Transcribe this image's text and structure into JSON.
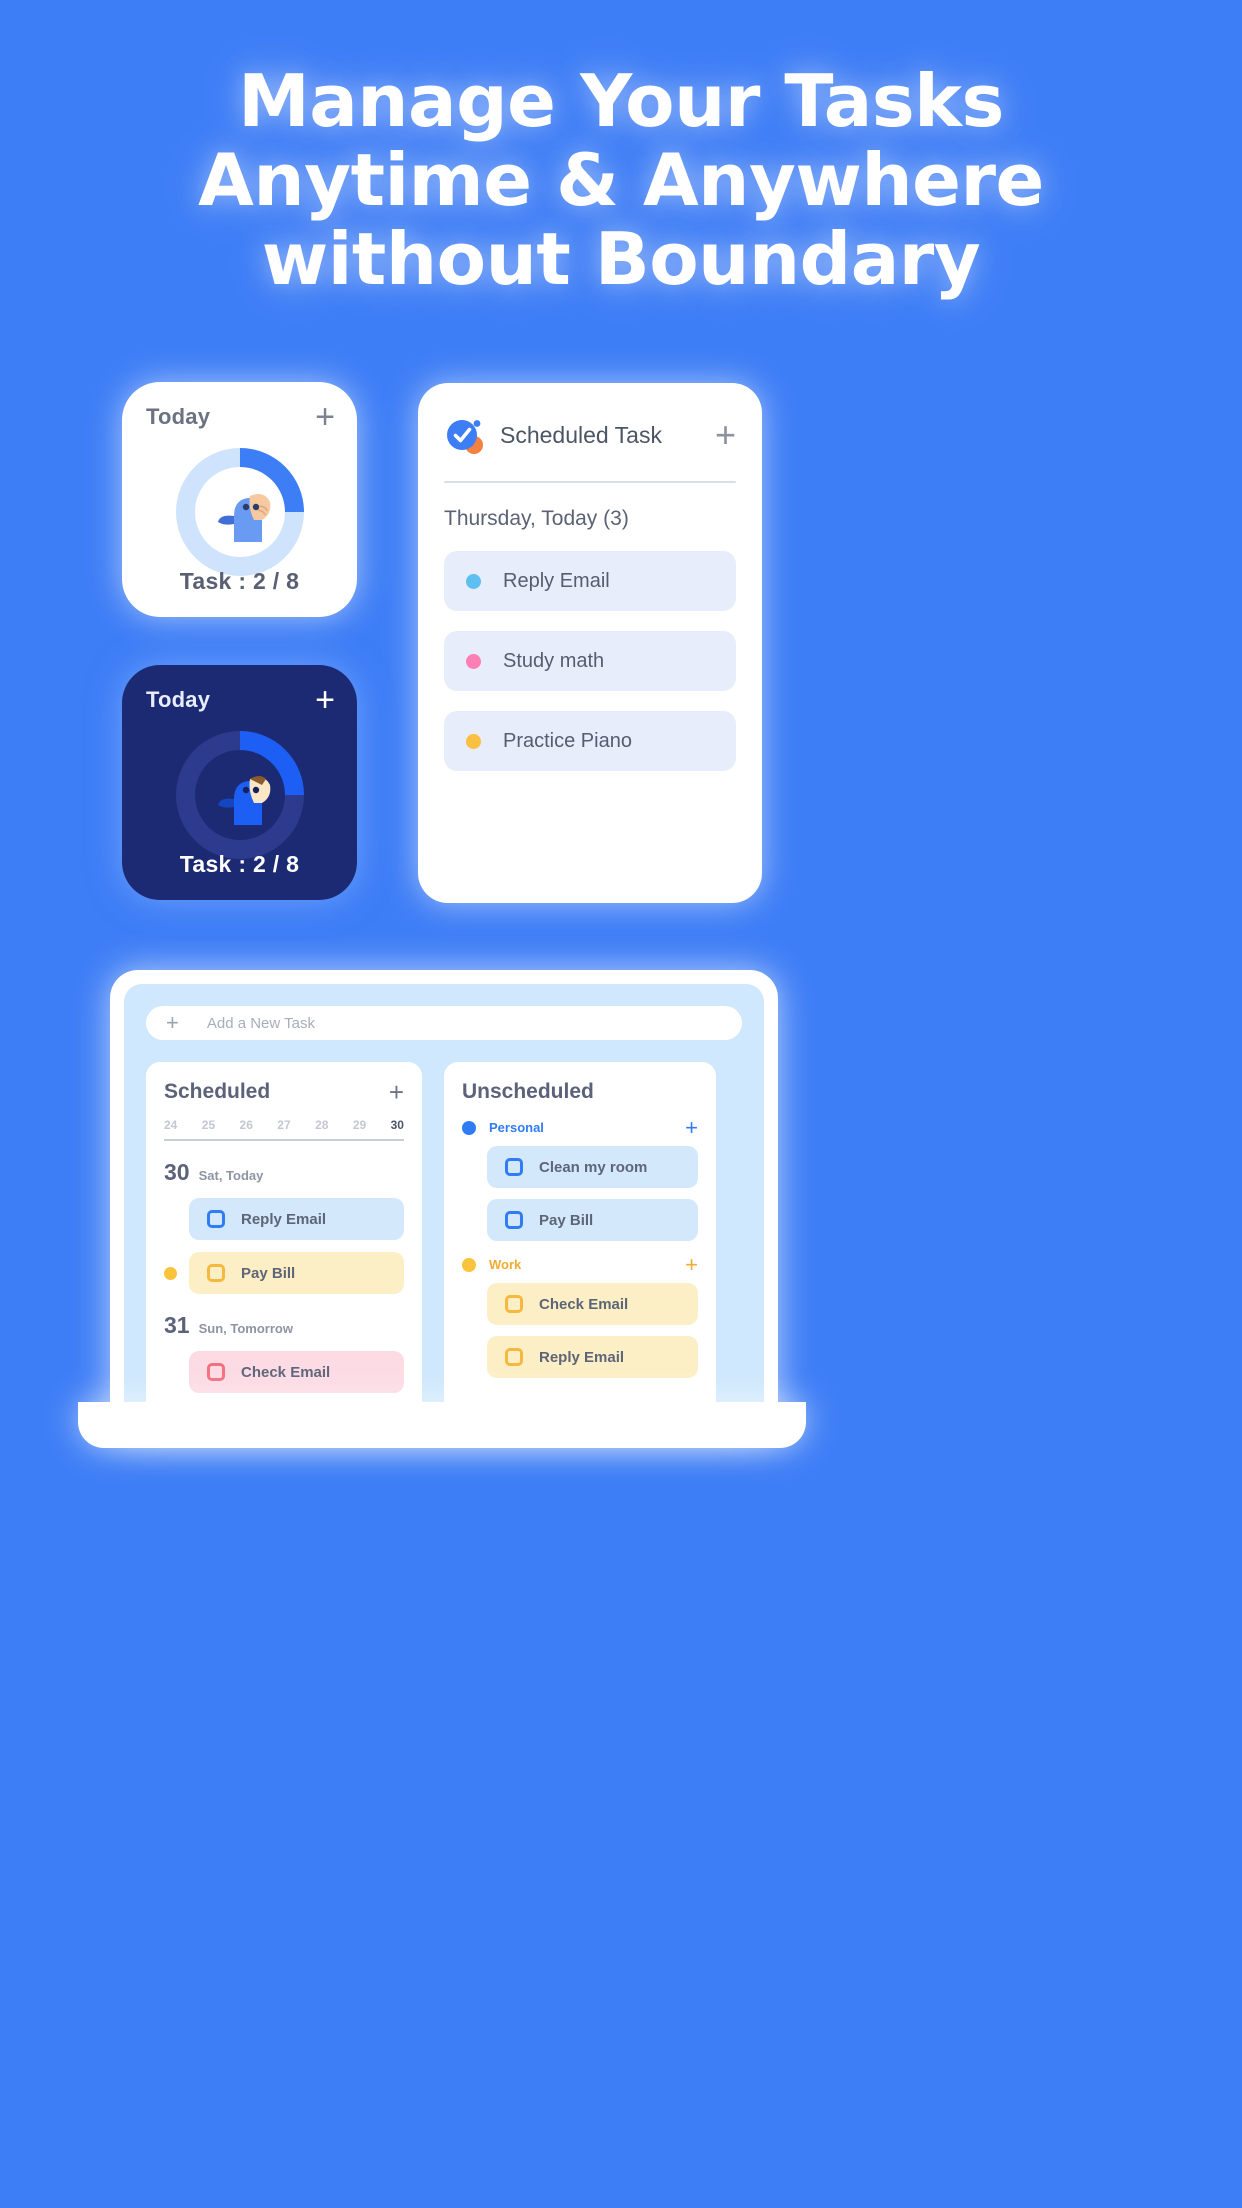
{
  "page": {
    "background_color": "#3d7df6"
  },
  "headline": {
    "line1": "Manage Your Tasks",
    "line2": "Anytime & Anywhere",
    "line3": "without Boundary",
    "color": "#ffffff"
  },
  "widget_light": {
    "title": "Today",
    "add_label": "+",
    "task_label": "Task :  2 / 8",
    "progress": {
      "completed": 2,
      "total": 8,
      "percent": 25
    },
    "arc_color": "#3d7df6",
    "track_color": "#cfe4fc",
    "background": "#ffffff"
  },
  "widget_dark": {
    "title": "Today",
    "add_label": "+",
    "task_label": "Task :  2 / 8",
    "progress": {
      "completed": 2,
      "total": 8,
      "percent": 25
    },
    "arc_color": "#1d5ff5",
    "track_color": "#2c3b8e",
    "background": "#1b2a73"
  },
  "scheduled_card": {
    "app_title": "Scheduled Task",
    "add_label": "+",
    "day_header": "Thursday, Today (3)",
    "items": [
      {
        "label": "Reply Email",
        "dot_color": "#5ec0f0"
      },
      {
        "label": "Study math",
        "dot_color": "#fd7fb3"
      },
      {
        "label": "Practice Piano",
        "dot_color": "#f9c042"
      }
    ]
  },
  "laptop": {
    "add_task": {
      "placeholder": "Add a New Task",
      "plus_label": "+"
    },
    "scheduled_panel": {
      "title": "Scheduled",
      "add_label": "+",
      "dates": [
        {
          "label": "24",
          "active": false
        },
        {
          "label": "25",
          "active": false
        },
        {
          "label": "26",
          "active": false
        },
        {
          "label": "27",
          "active": false
        },
        {
          "label": "28",
          "active": false
        },
        {
          "label": "29",
          "active": false
        },
        {
          "label": "30",
          "active": true
        }
      ],
      "days": [
        {
          "num": "30",
          "label": "Sat, Today",
          "tasks": [
            {
              "label": "Reply Email",
              "bg": "#d4e8fb",
              "box_color": "#2f7cf6",
              "dot_color": null
            },
            {
              "label": "Pay Bill",
              "bg": "#fdefc5",
              "box_color": "#f6b93f",
              "dot_color": "#f9c33c"
            }
          ]
        },
        {
          "num": "31",
          "label": "Sun, Tomorrow",
          "tasks": [
            {
              "label": "Check Email",
              "bg": "#fcdbe5",
              "box_color": "#f4707f",
              "dot_color": null
            }
          ]
        }
      ]
    },
    "unscheduled_panel": {
      "title": "Unscheduled",
      "groups": [
        {
          "name": "Personal",
          "dot_color": "#2f7cf6",
          "label_color": "#2f7cf6",
          "add_label": "+",
          "tasks": [
            {
              "label": "Clean my room",
              "bg": "#d4e8fb",
              "box_color": "#2f7cf6"
            },
            {
              "label": "Pay Bill",
              "bg": "#d4e8fb",
              "box_color": "#2f7cf6"
            }
          ]
        },
        {
          "name": "Work",
          "dot_color": "#f9c33c",
          "label_color": "#f0ab30",
          "add_label": "+",
          "tasks": [
            {
              "label": "Check Email",
              "bg": "#fdefc5",
              "box_color": "#f6b93f"
            },
            {
              "label": "Reply Email",
              "bg": "#fdefc5",
              "box_color": "#f6b93f"
            }
          ]
        }
      ]
    }
  }
}
